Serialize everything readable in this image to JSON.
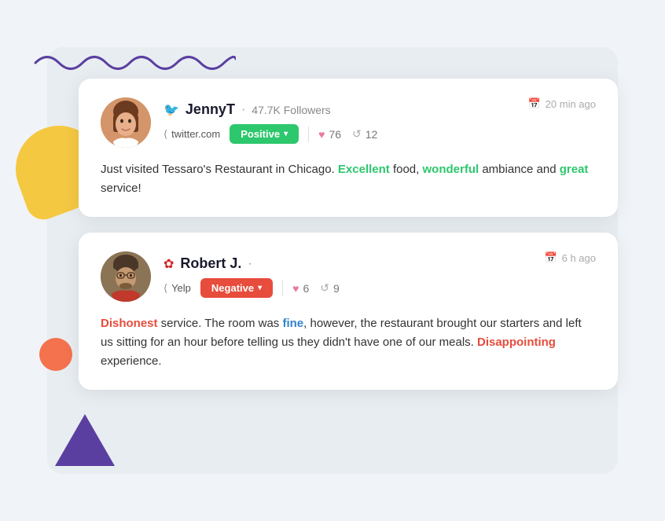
{
  "decorative": {
    "wave_color": "#5b3fa0",
    "yellow_color": "#f5c842",
    "orange_color": "#f4724e",
    "triangle_color": "#5b3fa0"
  },
  "cards": [
    {
      "id": "card-jenny",
      "avatar_label": "JennyT avatar",
      "platform_icon": "🐦",
      "platform_name": "twitter",
      "username": "JennyT",
      "dot": "·",
      "followers": "47.7K Followers",
      "source_icon": "⟨",
      "source": "twitter.com",
      "badge_label": "Positive",
      "badge_chevron": "▾",
      "badge_type": "positive",
      "heart_count": "76",
      "retweet_count": "12",
      "timestamp": "20 min ago",
      "body_parts": [
        {
          "text": "Just visited Tessaro's Restaurant in Chicago. ",
          "type": "normal"
        },
        {
          "text": "Excellent",
          "type": "positive"
        },
        {
          "text": " food, ",
          "type": "normal"
        },
        {
          "text": "wonderful",
          "type": "positive"
        },
        {
          "text": " ambiance and ",
          "type": "normal"
        },
        {
          "text": "great",
          "type": "positive"
        },
        {
          "text": " service!",
          "type": "normal"
        }
      ]
    },
    {
      "id": "card-robert",
      "avatar_label": "Robert J. avatar",
      "platform_icon": "❋",
      "platform_name": "yelp",
      "username": "Robert J.",
      "dot": "·",
      "followers": "",
      "source_icon": "⟨",
      "source": "Yelp",
      "badge_label": "Negative",
      "badge_chevron": "▾",
      "badge_type": "negative",
      "heart_count": "6",
      "retweet_count": "9",
      "timestamp": "6 h ago",
      "body_parts": [
        {
          "text": "Dishonest",
          "type": "negative"
        },
        {
          "text": " service. The room was ",
          "type": "normal"
        },
        {
          "text": "fine",
          "type": "neutral"
        },
        {
          "text": ", however, the restaurant brought our starters and left us sitting for an hour before telling us they didn't have one of our meals. ",
          "type": "normal"
        },
        {
          "text": "Disappointing",
          "type": "negative"
        },
        {
          "text": " experience.",
          "type": "normal"
        }
      ]
    }
  ],
  "icons": {
    "twitter": "🐦",
    "yelp": "✿",
    "calendar": "📅",
    "heart": "♥",
    "retweet": "⟳",
    "chevron_down": "▾",
    "share": "⟨"
  }
}
